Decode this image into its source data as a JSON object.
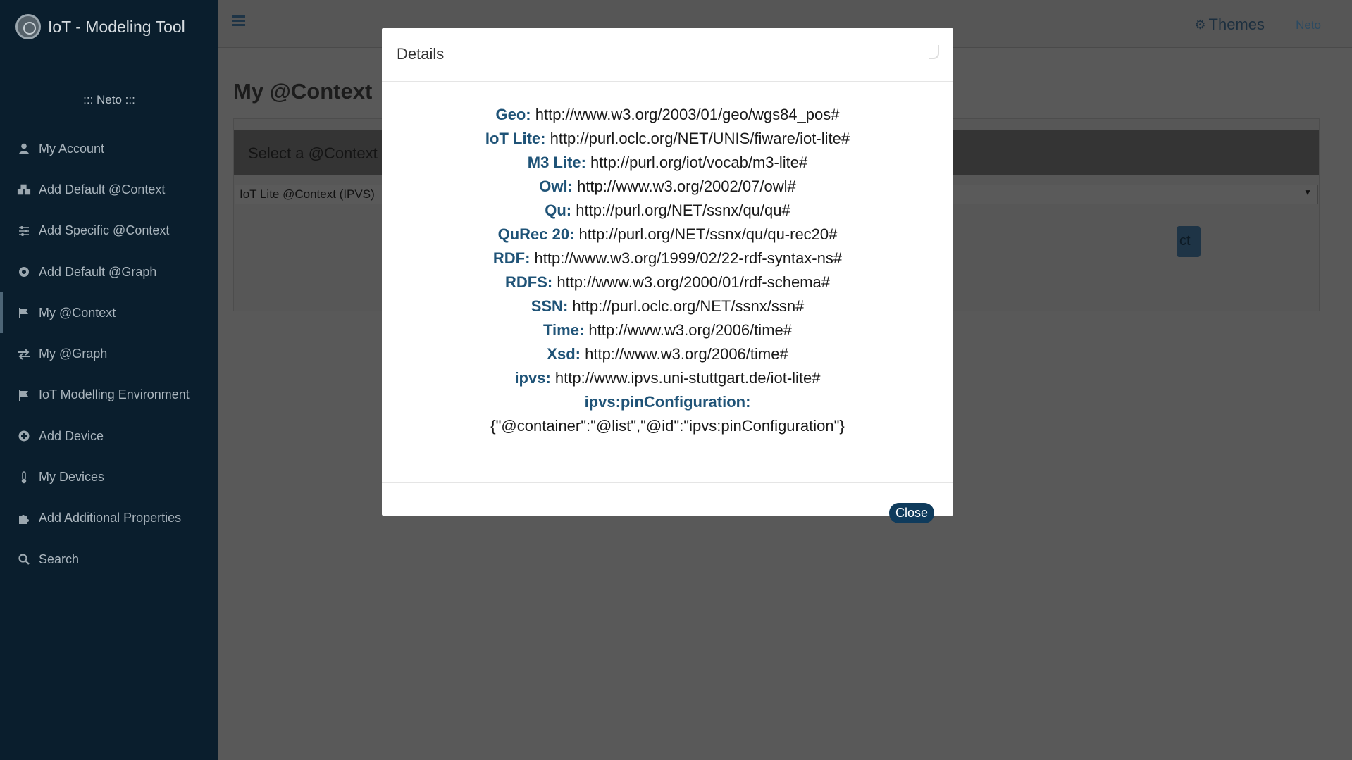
{
  "app": {
    "title": "IoT - Modeling Tool"
  },
  "sidebar": {
    "user_line": "::: Neto :::",
    "items": [
      {
        "label": "My Account",
        "icon": "user-icon"
      },
      {
        "label": "Add Default @Context",
        "icon": "cubes-icon"
      },
      {
        "label": "Add Specific @Context",
        "icon": "sliders-icon"
      },
      {
        "label": "Add Default @Graph",
        "icon": "compass-icon"
      },
      {
        "label": "My @Context",
        "icon": "flag-icon",
        "active": true
      },
      {
        "label": "My @Graph",
        "icon": "exchange-icon"
      },
      {
        "label": "IoT Modelling Environment",
        "icon": "flag-icon"
      },
      {
        "label": "Add Device",
        "icon": "plus-circle-icon"
      },
      {
        "label": "My Devices",
        "icon": "thermometer-icon"
      },
      {
        "label": "Add Additional Properties",
        "icon": "puzzle-icon"
      },
      {
        "label": "Search",
        "icon": "search-icon"
      }
    ]
  },
  "topbar": {
    "themes_label": "Themes",
    "user_label": "Neto"
  },
  "main": {
    "page_title": "My @Context",
    "card_header": "Select a @Context",
    "select_value": "IoT Lite @Context (IPVS)",
    "ghost_button_text": "ct"
  },
  "modal": {
    "title": "Details",
    "rows": [
      {
        "key": "Geo:",
        "value": "http://www.w3.org/2003/01/geo/wgs84_pos#"
      },
      {
        "key": "IoT Lite:",
        "value": "http://purl.oclc.org/NET/UNIS/fiware/iot-lite#"
      },
      {
        "key": "M3 Lite:",
        "value": "http://purl.org/iot/vocab/m3-lite#"
      },
      {
        "key": "Owl:",
        "value": "http://www.w3.org/2002/07/owl#"
      },
      {
        "key": "Qu:",
        "value": "http://purl.org/NET/ssnx/qu/qu#"
      },
      {
        "key": "QuRec 20:",
        "value": "http://purl.org/NET/ssnx/qu/qu-rec20#"
      },
      {
        "key": "RDF:",
        "value": "http://www.w3.org/1999/02/22-rdf-syntax-ns#"
      },
      {
        "key": "RDFS:",
        "value": "http://www.w3.org/2000/01/rdf-schema#"
      },
      {
        "key": "SSN:",
        "value": "http://purl.oclc.org/NET/ssnx/ssn#"
      },
      {
        "key": "Time:",
        "value": "http://www.w3.org/2006/time#"
      },
      {
        "key": "Xsd:",
        "value": "http://www.w3.org/2006/time#"
      },
      {
        "key": "ipvs:",
        "value": "http://www.ipvs.uni-stuttgart.de/iot-lite#"
      },
      {
        "key": "ipvs:pinConfiguration:",
        "value": ""
      },
      {
        "key": "",
        "value": "{\"@container\":\"@list\",\"@id\":\"ipvs:pinConfiguration\"}"
      }
    ],
    "close_label": "Close"
  },
  "colors": {
    "sidebar_bg": "#0a1e2d",
    "accent": "#0f3b5c",
    "key_text": "#1f5377"
  }
}
